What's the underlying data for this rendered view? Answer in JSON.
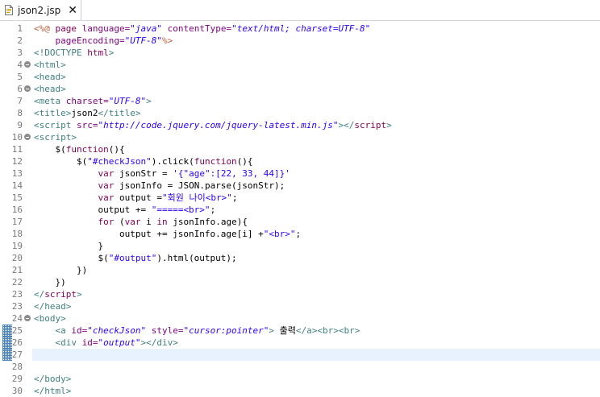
{
  "tab": {
    "title": "json2.jsp"
  },
  "current_line": 27,
  "lines": [
    {
      "n": "1",
      "fold": false,
      "tokens": [
        {
          "t": "<%@ ",
          "c": "t-jsp"
        },
        {
          "t": "page ",
          "c": "t-keyword"
        },
        {
          "t": "language=",
          "c": "t-attr"
        },
        {
          "t": "\"java\"",
          "c": "t-str"
        },
        {
          "t": " contentType=",
          "c": "t-attr"
        },
        {
          "t": "\"text/html; charset=UTF-8\"",
          "c": "t-str"
        }
      ]
    },
    {
      "n": "2",
      "fold": false,
      "tokens": [
        {
          "t": "    pageEncoding=",
          "c": "t-attr"
        },
        {
          "t": "\"UTF-8\"",
          "c": "t-str"
        },
        {
          "t": "%>",
          "c": "t-jsp"
        }
      ]
    },
    {
      "n": "3",
      "fold": false,
      "tokens": [
        {
          "t": "<!DOCTYPE ",
          "c": "t-doctype"
        },
        {
          "t": "html",
          "c": "t-keyword"
        },
        {
          "t": ">",
          "c": "t-doctype"
        }
      ]
    },
    {
      "n": "4",
      "fold": true,
      "tokens": [
        {
          "t": "<html>",
          "c": "t-tag"
        }
      ]
    },
    {
      "n": "5",
      "fold": false,
      "tokens": [
        {
          "t": "<head>",
          "c": "t-tag"
        }
      ]
    },
    {
      "n": "6",
      "fold": true,
      "tokens": [
        {
          "t": "<head>",
          "c": "t-tag"
        }
      ]
    },
    {
      "n": "7",
      "fold": false,
      "tokens": [
        {
          "t": "<meta ",
          "c": "t-tag"
        },
        {
          "t": "charset=",
          "c": "t-attr"
        },
        {
          "t": "\"UTF-8\"",
          "c": "t-str"
        },
        {
          "t": ">",
          "c": "t-tag"
        }
      ]
    },
    {
      "n": "8",
      "fold": false,
      "tokens": [
        {
          "t": "<title>",
          "c": "t-tag"
        },
        {
          "t": "json2",
          "c": "t-plain"
        },
        {
          "t": "</title>",
          "c": "t-tag"
        }
      ]
    },
    {
      "n": "9",
      "fold": false,
      "tokens": [
        {
          "t": "<script ",
          "c": "t-tag"
        },
        {
          "t": "src=",
          "c": "t-attr"
        },
        {
          "t": "\"http://code.jquery.com/jquery-latest.min.js\"",
          "c": "t-str"
        },
        {
          "t": "></",
          "c": "t-tag"
        },
        {
          "t": "script",
          "c": "t-kwjs"
        },
        {
          "t": ">",
          "c": "t-tag"
        }
      ]
    },
    {
      "n": "10",
      "fold": true,
      "tokens": [
        {
          "t": "<script>",
          "c": "t-tag"
        }
      ]
    },
    {
      "n": "11",
      "fold": false,
      "tokens": [
        {
          "t": "    $(",
          "c": "t-plain"
        },
        {
          "t": "function",
          "c": "t-kwjs"
        },
        {
          "t": "(){",
          "c": "t-plain"
        }
      ]
    },
    {
      "n": "12",
      "fold": false,
      "tokens": [
        {
          "t": "        $(",
          "c": "t-plain"
        },
        {
          "t": "\"#checkJson\"",
          "c": "t-jsstr"
        },
        {
          "t": ").click(",
          "c": "t-plain"
        },
        {
          "t": "function",
          "c": "t-kwjs"
        },
        {
          "t": "(){",
          "c": "t-plain"
        }
      ]
    },
    {
      "n": "13",
      "fold": false,
      "tokens": [
        {
          "t": "            ",
          "c": "t-plain"
        },
        {
          "t": "var",
          "c": "t-kwjs"
        },
        {
          "t": " jsonStr = ",
          "c": "t-plain"
        },
        {
          "t": "'{\"age\":[22, 33, 44]}'",
          "c": "t-jsstr"
        }
      ]
    },
    {
      "n": "14",
      "fold": false,
      "tokens": [
        {
          "t": "            ",
          "c": "t-plain"
        },
        {
          "t": "var",
          "c": "t-kwjs"
        },
        {
          "t": " jsonInfo = JSON.parse(jsonStr);",
          "c": "t-plain"
        }
      ]
    },
    {
      "n": "15",
      "fold": false,
      "tokens": [
        {
          "t": "            ",
          "c": "t-plain"
        },
        {
          "t": "var",
          "c": "t-kwjs"
        },
        {
          "t": " output =",
          "c": "t-plain"
        },
        {
          "t": "\"회원 나이<br>\"",
          "c": "t-jsstr"
        },
        {
          "t": ";",
          "c": "t-plain"
        }
      ]
    },
    {
      "n": "16",
      "fold": false,
      "tokens": [
        {
          "t": "            output += ",
          "c": "t-plain"
        },
        {
          "t": "\"=====<br>\"",
          "c": "t-jsstr"
        },
        {
          "t": ";",
          "c": "t-plain"
        }
      ]
    },
    {
      "n": "17",
      "fold": false,
      "tokens": [
        {
          "t": "            ",
          "c": "t-plain"
        },
        {
          "t": "for",
          "c": "t-kwjs"
        },
        {
          "t": " (",
          "c": "t-plain"
        },
        {
          "t": "var",
          "c": "t-kwjs"
        },
        {
          "t": " i ",
          "c": "t-plain"
        },
        {
          "t": "in",
          "c": "t-kwjs"
        },
        {
          "t": " jsonInfo.age){",
          "c": "t-plain"
        }
      ]
    },
    {
      "n": "18",
      "fold": false,
      "tokens": [
        {
          "t": "                output += jsonInfo.age[i] +",
          "c": "t-plain"
        },
        {
          "t": "\"<br>\"",
          "c": "t-jsstr"
        },
        {
          "t": ";",
          "c": "t-plain"
        }
      ]
    },
    {
      "n": "19",
      "fold": false,
      "tokens": [
        {
          "t": "            }",
          "c": "t-plain"
        }
      ]
    },
    {
      "n": "20",
      "fold": false,
      "tokens": [
        {
          "t": "            $(",
          "c": "t-plain"
        },
        {
          "t": "\"#output\"",
          "c": "t-jsstr"
        },
        {
          "t": ").html(output);",
          "c": "t-plain"
        }
      ]
    },
    {
      "n": "21",
      "fold": false,
      "tokens": [
        {
          "t": "        })",
          "c": "t-plain"
        }
      ]
    },
    {
      "n": "22",
      "fold": false,
      "tokens": [
        {
          "t": "    })",
          "c": "t-plain"
        }
      ]
    },
    {
      "n": "23",
      "fold": false,
      "tokens": [
        {
          "t": "</",
          "c": "t-tag"
        },
        {
          "t": "script",
          "c": "t-kwjs"
        },
        {
          "t": ">",
          "c": "t-tag"
        }
      ]
    },
    {
      "n": "23",
      "fold": false,
      "tokens": [
        {
          "t": "</head>",
          "c": "t-tag"
        }
      ]
    },
    {
      "n": "24",
      "fold": true,
      "tokens": [
        {
          "t": "<body>",
          "c": "t-tag"
        }
      ]
    },
    {
      "n": "25",
      "fold": false,
      "tokens": [
        {
          "t": "    <a ",
          "c": "t-tag"
        },
        {
          "t": "id=",
          "c": "t-attr"
        },
        {
          "t": "\"checkJson\"",
          "c": "t-str"
        },
        {
          "t": " style=",
          "c": "t-attr"
        },
        {
          "t": "\"cursor:pointer\"",
          "c": "t-str"
        },
        {
          "t": "> ",
          "c": "t-tag"
        },
        {
          "t": "출력",
          "c": "t-plain"
        },
        {
          "t": "</a><br><br>",
          "c": "t-tag"
        }
      ]
    },
    {
      "n": "26",
      "fold": false,
      "tokens": [
        {
          "t": "    <div ",
          "c": "t-tag"
        },
        {
          "t": "id=",
          "c": "t-attr"
        },
        {
          "t": "\"output\"",
          "c": "t-str"
        },
        {
          "t": "></div>",
          "c": "t-tag"
        }
      ]
    },
    {
      "n": "27",
      "fold": false,
      "tokens": []
    },
    {
      "n": "28",
      "fold": false,
      "tokens": []
    },
    {
      "n": "29",
      "fold": false,
      "tokens": [
        {
          "t": "</body>",
          "c": "t-tag"
        }
      ]
    },
    {
      "n": "30",
      "fold": false,
      "tokens": [
        {
          "t": "</html>",
          "c": "t-tag"
        }
      ]
    }
  ],
  "marked_lines": [
    "25",
    "26",
    "27"
  ],
  "colors": {
    "tag": "#3f7f7f",
    "attribute": "#7f007f",
    "string": "#2a00ff",
    "keyword": "#7f0055",
    "current_line": "#e8f2fe",
    "marker": "#2c6fb6"
  }
}
